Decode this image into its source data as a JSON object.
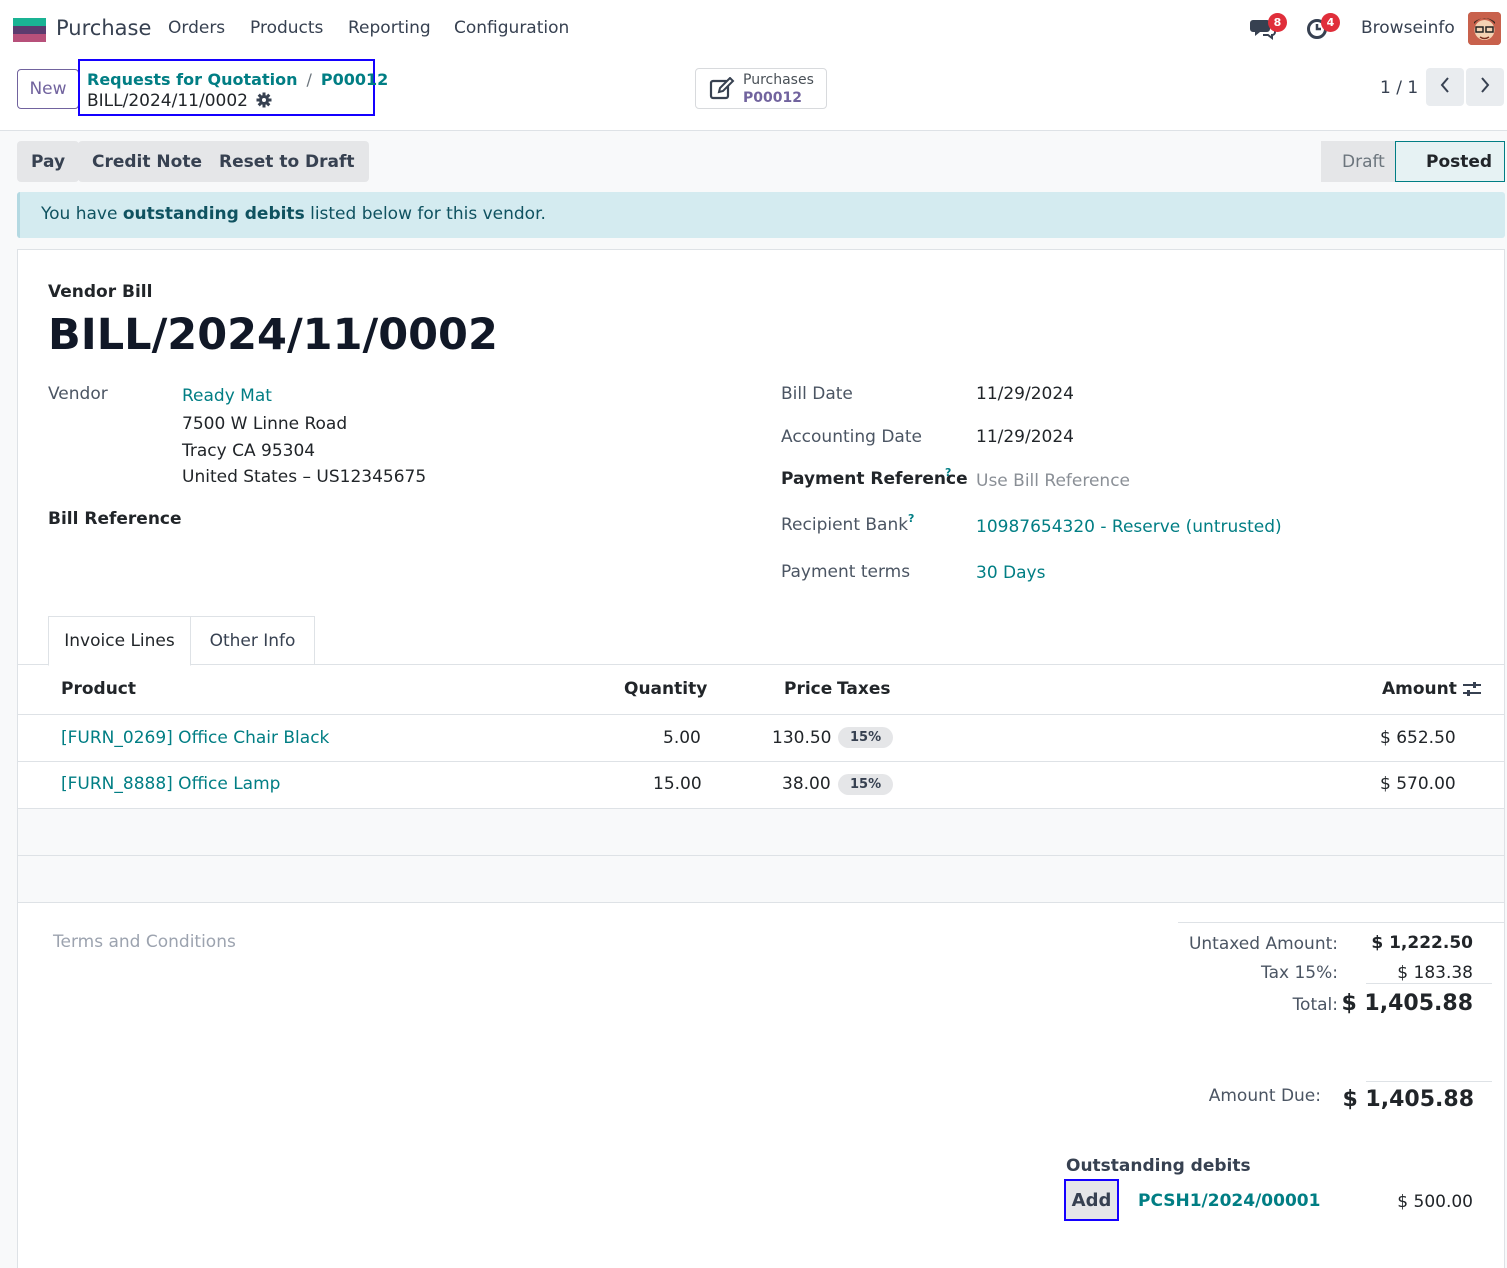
{
  "navbar": {
    "app_name": "Purchase",
    "menu": [
      "Orders",
      "Products",
      "Reporting",
      "Configuration"
    ],
    "messages_count": "8",
    "activities_count": "4",
    "user_name": "Browseinfo"
  },
  "control": {
    "new_label": "New",
    "breadcrumb_parent": "Requests for Quotation",
    "breadcrumb_sep": "/",
    "breadcrumb_order": "P00012",
    "breadcrumb_current": "BILL/2024/11/0002",
    "smart_button_label": "Purchases",
    "smart_button_value": "P00012",
    "pager": "1 / 1"
  },
  "actions": {
    "pay": "Pay",
    "credit_note": "Credit Note",
    "reset_to_draft": "Reset to Draft",
    "status_draft": "Draft",
    "status_posted": "Posted"
  },
  "alert": {
    "prefix": "You have ",
    "bold": "outstanding debits",
    "suffix": " listed below for this vendor."
  },
  "bill": {
    "type_label": "Vendor Bill",
    "number": "BILL/2024/11/0002",
    "vendor_label": "Vendor",
    "vendor_name": "Ready Mat",
    "vendor_address": [
      "7500 W Linne Road",
      "Tracy CA 95304",
      "United States – US12345675"
    ],
    "bill_reference_label": "Bill Reference",
    "bill_date_label": "Bill Date",
    "bill_date": "11/29/2024",
    "accounting_date_label": "Accounting Date",
    "accounting_date": "11/29/2024",
    "payment_reference_label": "Payment Reference",
    "payment_reference_placeholder": "Use Bill Reference",
    "recipient_bank_label": "Recipient Bank",
    "recipient_bank": "10987654320 - Reserve (untrusted)",
    "payment_terms_label": "Payment terms",
    "payment_terms": "30 Days",
    "help_mark": "?"
  },
  "tabs": [
    "Invoice Lines",
    "Other Info"
  ],
  "lines": {
    "headers": {
      "product": "Product",
      "quantity": "Quantity",
      "price": "Price",
      "taxes": "Taxes",
      "amount": "Amount"
    },
    "rows": [
      {
        "product": "[FURN_0269] Office Chair Black",
        "quantity": "5.00",
        "price": "130.50",
        "tax": "15%",
        "amount": "$ 652.50"
      },
      {
        "product": "[FURN_8888] Office Lamp",
        "quantity": "15.00",
        "price": "38.00",
        "tax": "15%",
        "amount": "$ 570.00"
      }
    ]
  },
  "totals": {
    "terms_placeholder": "Terms and Conditions",
    "untaxed_label": "Untaxed Amount:",
    "untaxed_value": "$ 1,222.50",
    "tax_label": "Tax 15%:",
    "tax_value": "$ 183.38",
    "total_label": "Total:",
    "total_value": "$ 1,405.88",
    "amount_due_label": "Amount Due:",
    "amount_due_value": "$ 1,405.88"
  },
  "outstanding": {
    "title": "Outstanding debits",
    "add_label": "Add",
    "reference": "PCSH1/2024/00001",
    "amount": "$ 500.00"
  }
}
